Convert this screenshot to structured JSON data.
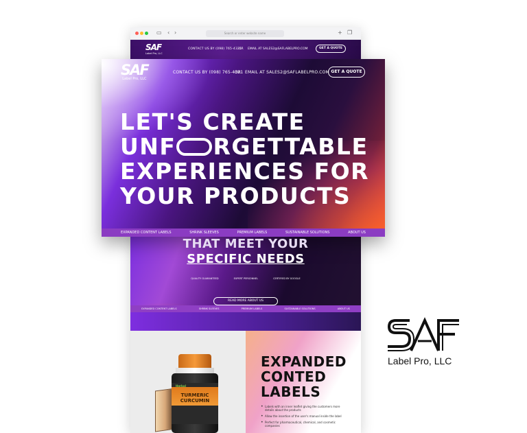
{
  "browser": {
    "address_placeholder": "Search or enter website name",
    "header": {
      "logo_mark": "SAF",
      "logo_sub": "Label Pro, LLC",
      "contact": "CONTACT US BY (098) 765-4321",
      "or": "OR",
      "email": "EMAIL AT SALES2@SAFLABELPRO.COM",
      "quote_button": "GET A QUOTE"
    },
    "tagline": [
      "THAT MEET YOUR",
      "SPECIFIC NEEDS"
    ],
    "badges": [
      "QUALITY GUARANTEED",
      "EXPERT PERSONNEL",
      "CERTIFIED BY GOOGLE"
    ],
    "read_more_button": "READ MORE ABOUT US",
    "nav": [
      "EXPANDED CONTENT LABELS",
      "SHRINK SLEEVES",
      "PREMIUM LABELS",
      "SUSTAINABLE SOLUTIONS",
      "ABOUT US"
    ],
    "product": {
      "brand": "Herbal",
      "name": "TURMERIC CURCUMIN"
    },
    "section_title": [
      "EXPANDED",
      "CONTED",
      "LABELS"
    ],
    "bullets": [
      "Labels with an inner leaflet giving the customers more details about the products",
      "Allow the insertion of the user's manual inside the label",
      "Perfect for pharmaceutical, chemical, and cosmetic companies"
    ]
  },
  "hero": {
    "logo_mark": "SAF",
    "logo_sub": "Label Pro, LLC",
    "contact": "CONTACT US BY (098) 765-4321",
    "or": "OR",
    "email": "EMAIL AT SALES2@SAFLABELPRO.COM",
    "quote_button": "GET A QUOTE",
    "headline_line1": "LET'S CREATE",
    "headline_line2_start": "UNF",
    "headline_line2_end": "RGETTABLE",
    "headline_line3": "EXPERIENCES FOR",
    "headline_line4": "YOUR PRODUCTS",
    "nav": [
      "EXPANDED CONTENT LABELS",
      "SHRINK SLEEVES",
      "PREMIUM LABELS",
      "SUSTAINABLE SOLUTIONS",
      "ABOUT US"
    ]
  },
  "brand_logo": {
    "mark": "SAF",
    "name": "Label Pro, LLC"
  },
  "colors": {
    "nav_purple": "#8b3cc2",
    "accent_orange": "#f05a28",
    "deep_purple": "#1d0b36"
  }
}
